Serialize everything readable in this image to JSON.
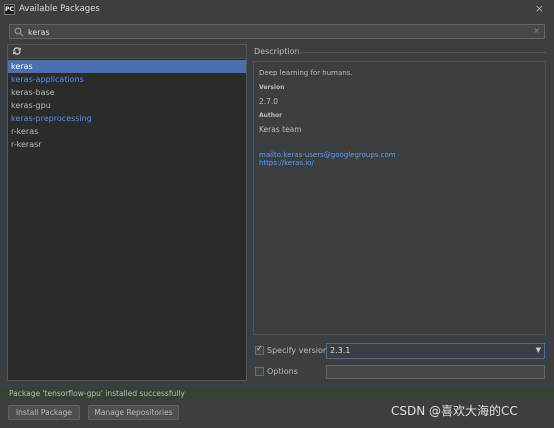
{
  "window": {
    "app_icon": "PC",
    "title": "Available Packages",
    "close_icon": "×"
  },
  "search": {
    "value": "keras",
    "clear_icon": "×"
  },
  "packages": [
    {
      "name": "keras",
      "selected": true
    },
    {
      "name": "keras-applications",
      "link": true
    },
    {
      "name": "keras-base"
    },
    {
      "name": "keras-gpu"
    },
    {
      "name": "keras-preprocessing",
      "link": true
    },
    {
      "name": "r-keras"
    },
    {
      "name": "r-kerasr"
    }
  ],
  "description": {
    "label": "Description",
    "summary": "Deep learning for humans.",
    "version_label": "Version",
    "version": "2.7.0",
    "author_label": "Author",
    "author": "Keras team",
    "email_link": "mailto:keras-users@googlegroups.com",
    "home_link": "https://keras.io/"
  },
  "options": {
    "specify_version_label": "Specify version",
    "specify_version_checked": true,
    "version_value": "2.3.1",
    "dropdown_icon": "▼",
    "options_label": "Options",
    "options_checked": false,
    "options_value": ""
  },
  "status": {
    "message": "Package 'tensorflow-gpu' installed successfully"
  },
  "buttons": {
    "install": "Install Package",
    "manage": "Manage Repositories"
  },
  "watermark": "CSDN @喜欢大海的CC",
  "colors": {
    "background": "#3c3f41",
    "list_background": "#2b2b2b",
    "selection": "#4b6eaf",
    "link": "#589df6",
    "status_bar": "#344134"
  }
}
